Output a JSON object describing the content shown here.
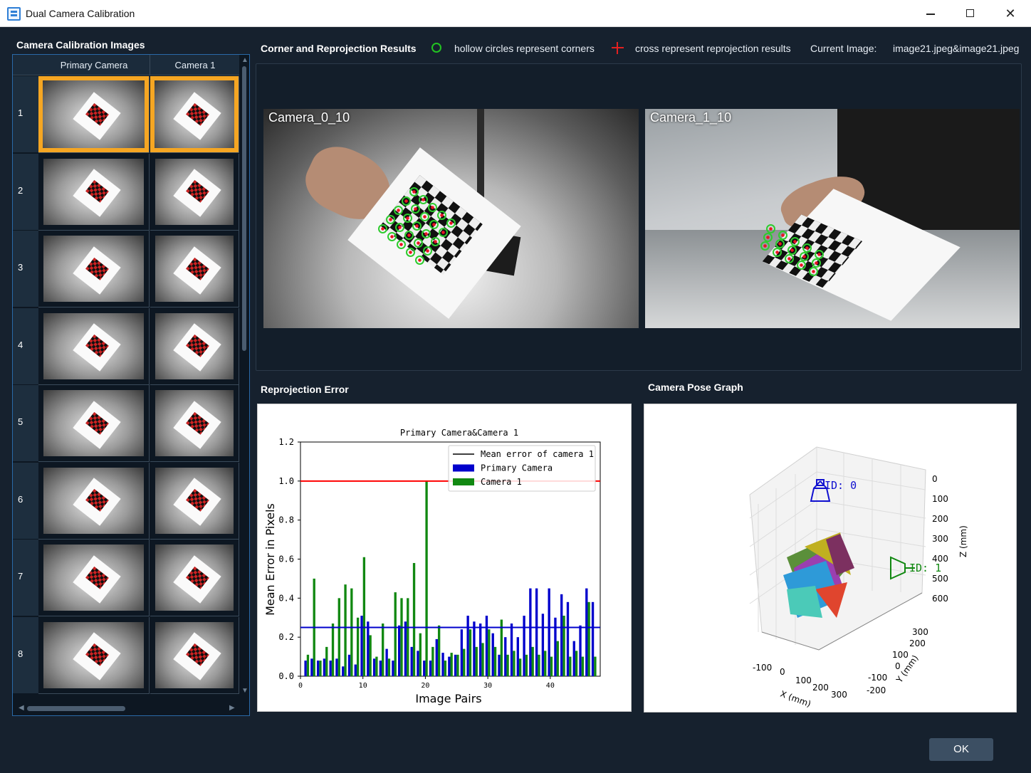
{
  "window": {
    "title": "Dual Camera Calibration"
  },
  "left": {
    "title": "Camera Calibration Images",
    "columns": [
      "Primary Camera",
      "Camera 1"
    ],
    "rows": [
      "1",
      "2",
      "3",
      "4",
      "5",
      "6",
      "7",
      "8"
    ],
    "selected_row": "1"
  },
  "results": {
    "title": "Corner and Reprojection Results",
    "legend_circle": "hollow circles represent corners",
    "legend_cross": "cross represent reprojection results",
    "current_label": "Current Image:",
    "current_value": "image21.jpeg&image21.jpeg",
    "cam0_label": "Camera_0_10",
    "cam1_label": "Camera_1_10"
  },
  "reproj": {
    "title": "Reprojection Error"
  },
  "pose": {
    "title": "Camera Pose Graph"
  },
  "ok_label": "OK",
  "colors": {
    "accent": "#f5a623",
    "corner": "#22c322",
    "reprojection": "#e32020",
    "primary_bar": "#0000cc",
    "camera1_bar": "#118811"
  },
  "chart_data": [
    {
      "type": "bar",
      "title": "Primary Camera&Camera 1",
      "xlabel": "Image Pairs",
      "ylabel": "Mean Error in Pixels",
      "xlim": [
        0,
        48
      ],
      "ylim": [
        0,
        1.2
      ],
      "xticks": [
        0,
        10,
        20,
        30,
        40
      ],
      "yticks": [
        0.0,
        0.2,
        0.4,
        0.6,
        0.8,
        1.0,
        1.2
      ],
      "legend": [
        "Mean error of camera 1",
        "Primary Camera",
        "Camera 1"
      ],
      "legend_position": "top-right",
      "hlines": [
        {
          "value": 1.0,
          "color": "#ff0000"
        },
        {
          "value": 0.25,
          "color": "#0000cc"
        }
      ],
      "x": [
        1,
        2,
        3,
        4,
        5,
        6,
        7,
        8,
        9,
        10,
        11,
        12,
        13,
        14,
        15,
        16,
        17,
        18,
        19,
        20,
        21,
        22,
        23,
        24,
        25,
        26,
        27,
        28,
        29,
        30,
        31,
        32,
        33,
        34,
        35,
        36,
        37,
        38,
        39,
        40,
        41,
        42,
        43,
        44,
        45,
        46,
        47
      ],
      "series": [
        {
          "name": "Primary Camera",
          "values": [
            0.08,
            0.09,
            0.08,
            0.09,
            0.08,
            0.09,
            0.05,
            0.11,
            0.06,
            0.31,
            0.28,
            0.09,
            0.08,
            0.14,
            0.08,
            0.26,
            0.28,
            0.15,
            0.13,
            0.08,
            0.08,
            0.19,
            0.12,
            0.1,
            0.11,
            0.24,
            0.31,
            0.28,
            0.27,
            0.31,
            0.22,
            0.11,
            0.2,
            0.27,
            0.2,
            0.31,
            0.45,
            0.45,
            0.32,
            0.45,
            0.3,
            0.42,
            0.38,
            0.18,
            0.26,
            0.45,
            0.38
          ]
        },
        {
          "name": "Camera 1",
          "values": [
            0.11,
            0.5,
            0.08,
            0.15,
            0.27,
            0.4,
            0.47,
            0.45,
            0.3,
            0.61,
            0.21,
            0.1,
            0.27,
            0.09,
            0.43,
            0.4,
            0.4,
            0.58,
            0.22,
            1.0,
            0.15,
            0.26,
            0.08,
            0.12,
            0.11,
            0.14,
            0.24,
            0.15,
            0.17,
            0.24,
            0.15,
            0.29,
            0.11,
            0.13,
            0.09,
            0.11,
            0.15,
            0.11,
            0.13,
            0.1,
            0.18,
            0.31,
            0.1,
            0.13,
            0.1,
            0.38,
            0.1
          ]
        }
      ]
    },
    {
      "type": "scatter",
      "title": "Camera Pose Graph",
      "xlabel": "X (mm)",
      "ylabel": "Y (mm)",
      "zlabel": "Z (mm)",
      "xticks": [
        -100,
        0,
        100,
        200,
        300
      ],
      "yticks": [
        -200,
        -100,
        0,
        100,
        200,
        300
      ],
      "zticks": [
        0,
        100,
        200,
        300,
        400,
        500,
        600
      ],
      "annotations": [
        "ID: 0",
        "ID: 1"
      ]
    }
  ]
}
